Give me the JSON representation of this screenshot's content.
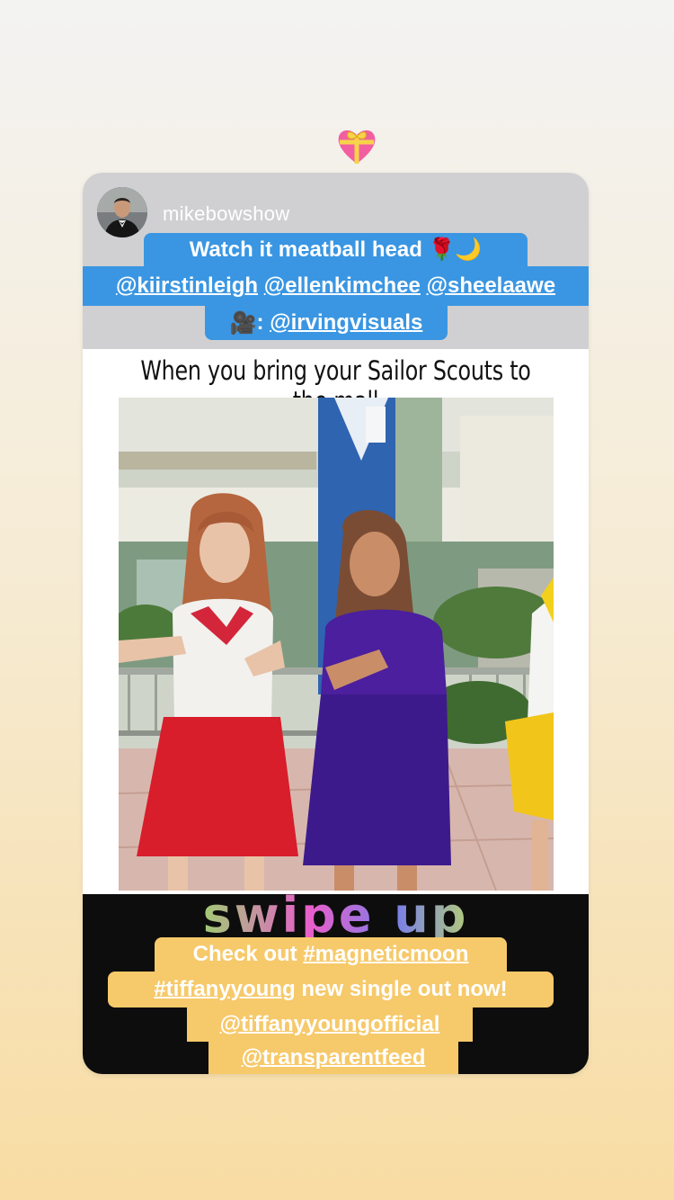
{
  "post": {
    "username": "mikebowshow",
    "caption_line1": "Watch it meatball head",
    "caption_line1_emoji": "🌹🌙",
    "mentions": [
      "@kiirstinleigh",
      "@ellenkimchee",
      "@sheelaawe"
    ],
    "camera_emoji": "🎥",
    "camera_sep": ":",
    "videographer": "@irvingvisuals"
  },
  "meme": {
    "title": "When you bring your Sailor Scouts to the mall"
  },
  "swipe": {
    "label": "swipe up"
  },
  "bottom_caption": {
    "prefix": "Check out",
    "hashtag1": "#magneticmoon",
    "hashtag2": "#tiffanyyoung",
    "suffix": "new single out now!",
    "mention1": "@tiffanyyoungofficial",
    "mention2": "@transparentfeed"
  },
  "icons": {
    "sticker": "gift-heart-icon",
    "avatar": "profile-avatar"
  },
  "colors": {
    "caption_blue": "#3a96e2",
    "caption_yellow": "#f6c96a",
    "header_gray": "#d0d0d2",
    "swipe_band": "#0d0d0d"
  }
}
